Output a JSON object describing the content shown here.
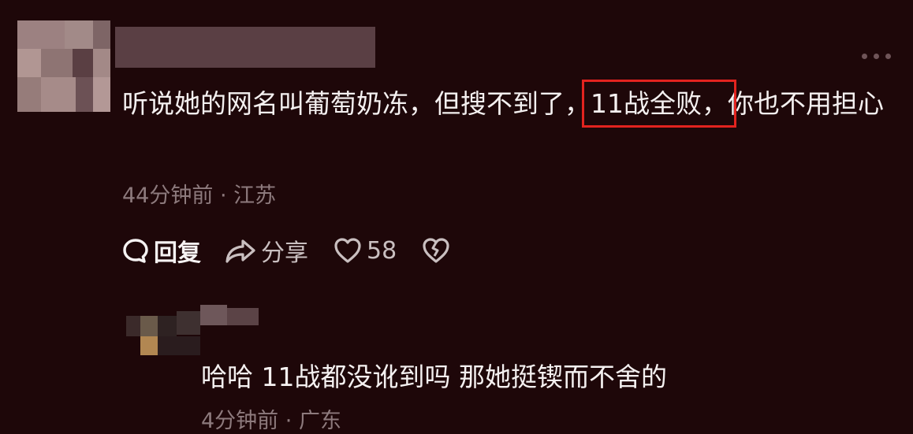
{
  "comment": {
    "text_before": "听说她的网名叫葡萄奶冻，但搜不到了，",
    "highlight": "11战全败，",
    "text_after": "你也不用担心",
    "time": "44分钟前",
    "separator": "·",
    "location": "江苏"
  },
  "actions": {
    "reply_label": "回复",
    "share_label": "分享",
    "like_count": "58"
  },
  "reply": {
    "text": "哈哈 11战都没讹到吗 那她挺锲而不舍的",
    "time": "4分钟前",
    "separator": "·",
    "location": "广东"
  },
  "colors": {
    "background": "#1e0709",
    "highlight_border": "#e2231f",
    "meta_text": "#8d7a7d"
  }
}
